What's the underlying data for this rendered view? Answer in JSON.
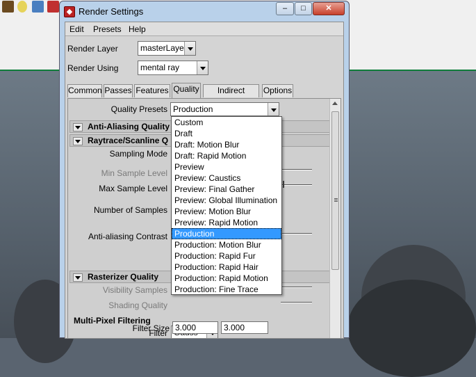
{
  "window": {
    "title": "Render Settings"
  },
  "menu": [
    "Edit",
    "Presets",
    "Help"
  ],
  "render_layer": {
    "label": "Render Layer",
    "value": "masterLayer"
  },
  "render_using": {
    "label": "Render Using",
    "value": "mental ray"
  },
  "tabs": [
    "Common",
    "Passes",
    "Features",
    "Quality",
    "Indirect Lighting",
    "Options"
  ],
  "active_tab": "Quality",
  "quality_presets": {
    "label": "Quality Presets",
    "value": "Production",
    "options": [
      "Custom",
      "Draft",
      "Draft: Motion Blur",
      "Draft: Rapid Motion",
      "Preview",
      "Preview: Caustics",
      "Preview: Final Gather",
      "Preview: Global Illumination",
      "Preview: Motion Blur",
      "Preview: Rapid Motion",
      "Production",
      "Production: Motion Blur",
      "Production: Rapid Fur",
      "Production: Rapid Hair",
      "Production: Rapid Motion",
      "Production: Fine Trace"
    ],
    "selected_index": 10
  },
  "sections": {
    "anti_aliasing": "Anti-Aliasing Quality",
    "raytrace": "Raytrace/Scanline Q",
    "rasterizer": "Rasterizer Quality",
    "multipixel": "Multi-Pixel Filtering"
  },
  "labels": {
    "sampling_mode": "Sampling Mode",
    "min_sample": "Min Sample Level",
    "max_sample": "Max Sample Level",
    "num_samples": "Number of Samples",
    "aa_contrast": "Anti-aliasing Contrast",
    "visibility_samples": "Visibility Samples",
    "shading_quality": "Shading Quality",
    "filter": "Filter",
    "filter_size": "Filter Size"
  },
  "filter": {
    "value": "Gauss",
    "size_x": "3.000",
    "size_y": "3.000"
  },
  "colors": {
    "selection": "#3399ff",
    "titlebar": "#b9d1ea",
    "viewport_line": "#0f7c3a"
  }
}
